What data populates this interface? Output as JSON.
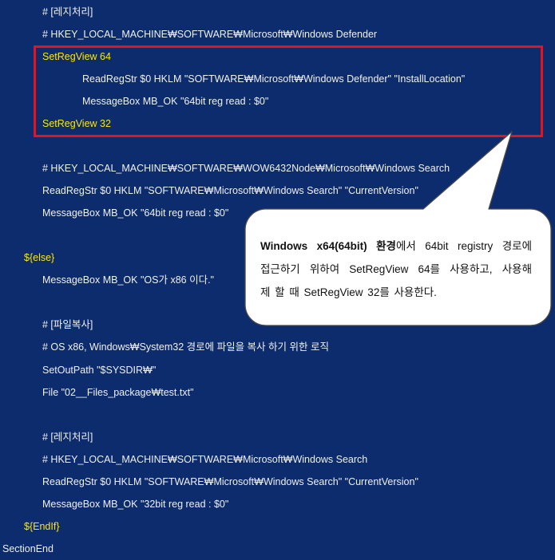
{
  "colors": {
    "background": "#0c2c6e",
    "text": "#f0f0f0",
    "keyword": "#ffe600",
    "highlight_box": "#e5141b",
    "callout_fill": "#ffffff",
    "callout_border": "#4a4a4a",
    "callout_text": "#111111"
  },
  "code": {
    "lines": [
      "# [레지처리]",
      "# HKEY_LOCAL_MACHINE₩SOFTWARE₩Microsoft₩Windows Defender",
      "SetRegView 64",
      "ReadRegStr $0 HKLM \"SOFTWARE₩Microsoft₩Windows Defender\" \"InstallLocation\"",
      "MessageBox MB_OK \"64bit reg read : $0\"",
      "SetRegView 32",
      "# HKEY_LOCAL_MACHINE₩SOFTWARE₩WOW6432Node₩Microsoft₩Windows Search",
      "ReadRegStr $0 HKLM \"SOFTWARE₩Microsoft₩Windows Search\" \"CurrentVersion\"",
      "MessageBox MB_OK \"64bit reg read : $0\"",
      "${else}",
      "MessageBox MB_OK \"OS가 x86 이다.\"",
      "# [파일복사]",
      "# OS x86, Windows₩System32 경로에 파일을 복사 하기 위한 로직",
      "SetOutPath \"$SYSDIR₩\"",
      "File \"02__Files_package₩test.txt\"",
      "# [레지처리]",
      "# HKEY_LOCAL_MACHINE₩SOFTWARE₩Microsoft₩Windows Search",
      "ReadRegStr $0 HKLM \"SOFTWARE₩Microsoft₩Windows Search\" \"CurrentVersion\"",
      "MessageBox MB_OK \"32bit reg read : $0\"",
      "${EndIf}",
      "SectionEnd"
    ]
  },
  "callout": {
    "line1_bold": "Windows x64(64bit) 환경",
    "line1_rest": "에서 64bit registry 경로에",
    "line2": "접근하기 위하여 SetRegView 64를 사용하고, 사용해",
    "line3": "제 할 때 SetRegView 32를 사용한다."
  }
}
